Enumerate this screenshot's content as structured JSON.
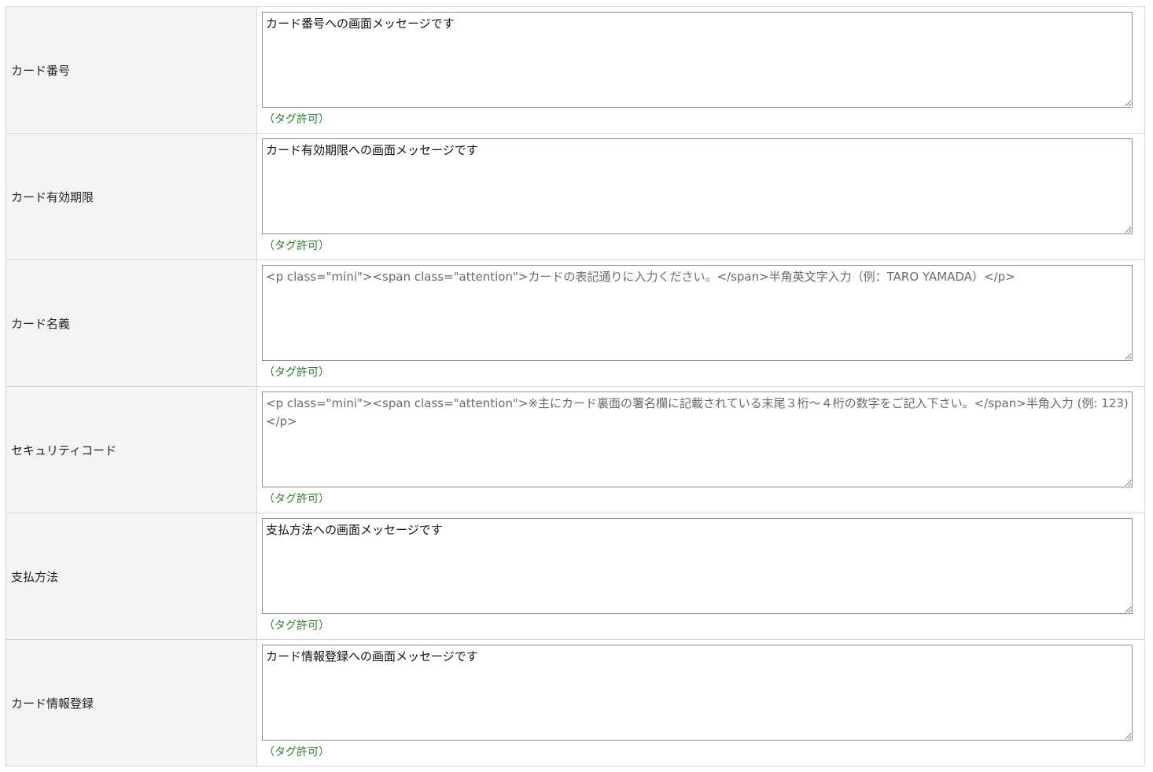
{
  "rows": [
    {
      "label": "カード番号",
      "value": "カード番号への画面メッセージです",
      "placeholder": "",
      "note": "（タグ許可）"
    },
    {
      "label": "カード有効期限",
      "value": "カード有効期限への画面メッセージです",
      "placeholder": "",
      "note": "（タグ許可）"
    },
    {
      "label": "カード名義",
      "value": "",
      "placeholder": "<p class=\"mini\"><span class=\"attention\">カードの表記通りに入力ください。</span>半角英文字入力（例：TARO YAMADA）</p>",
      "note": "（タグ許可）"
    },
    {
      "label": "セキュリティコード",
      "value": "",
      "placeholder": "<p class=\"mini\"><span class=\"attention\">※主にカード裏面の署名欄に記載されている末尾３桁～４桁の数字をご記入下さい。</span>半角入力 (例: 123)</p>",
      "note": "（タグ許可）"
    },
    {
      "label": "支払方法",
      "value": "支払方法への画面メッセージです",
      "placeholder": "",
      "note": "（タグ許可）"
    },
    {
      "label": "カード情報登録",
      "value": "カード情報登録への画面メッセージです",
      "placeholder": "",
      "note": "（タグ許可）"
    }
  ]
}
